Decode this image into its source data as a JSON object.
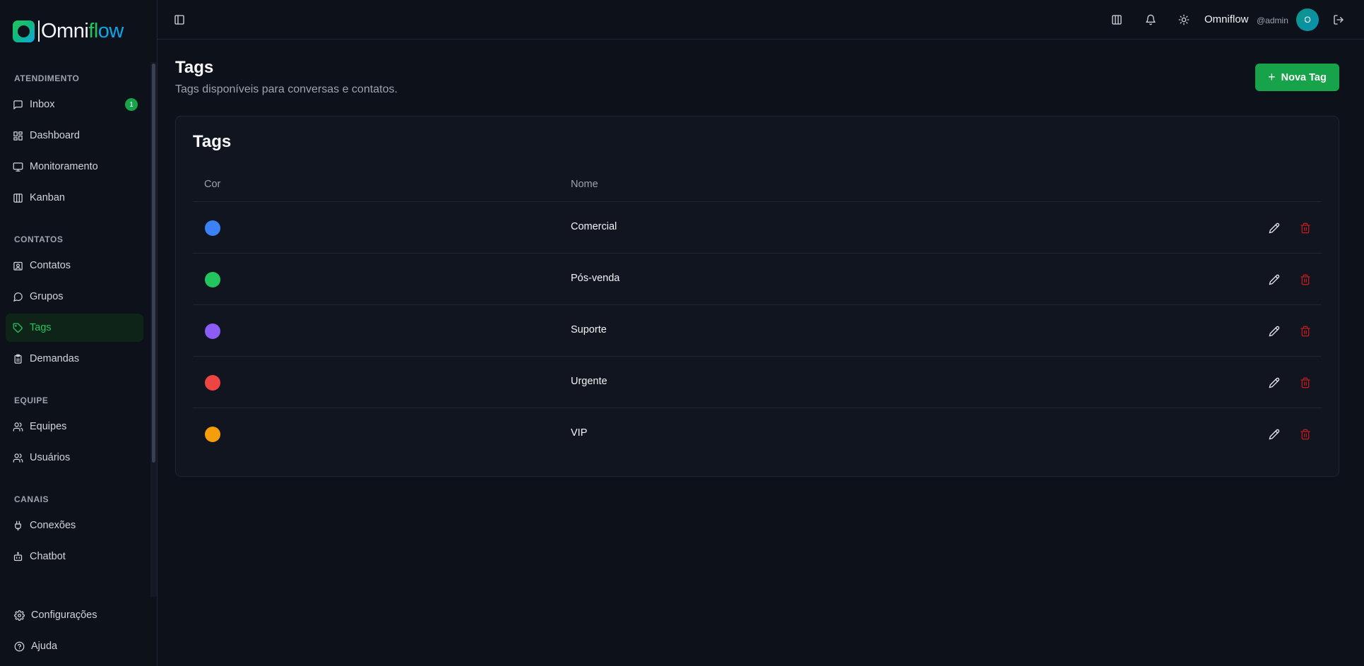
{
  "brand": {
    "logo_text_a": "Omni",
    "logo_text_b": "fl",
    "logo_text_c": "ow"
  },
  "sidebar": {
    "sections": [
      {
        "title": "ATENDIMENTO"
      },
      {
        "title": "CONTATOS"
      },
      {
        "title": "EQUIPE"
      },
      {
        "title": "CANAIS"
      }
    ],
    "items": [
      {
        "label": "Inbox",
        "icon": "message-square-icon",
        "badge": "1"
      },
      {
        "label": "Dashboard",
        "icon": "layout-dashboard-icon"
      },
      {
        "label": "Monitoramento",
        "icon": "monitor-icon"
      },
      {
        "label": "Kanban",
        "icon": "kanban-icon"
      },
      {
        "label": "Contatos",
        "icon": "contact-icon"
      },
      {
        "label": "Grupos",
        "icon": "message-circle-icon"
      },
      {
        "label": "Tags",
        "icon": "tag-icon",
        "active": true
      },
      {
        "label": "Demandas",
        "icon": "clipboard-icon"
      },
      {
        "label": "Equipes",
        "icon": "users-icon"
      },
      {
        "label": "Usuários",
        "icon": "users-icon"
      },
      {
        "label": "Conexões",
        "icon": "plug-icon"
      },
      {
        "label": "Chatbot",
        "icon": "bot-icon"
      }
    ],
    "bottom": [
      {
        "label": "Configurações",
        "icon": "gear-icon"
      },
      {
        "label": "Ajuda",
        "icon": "help-circle-icon"
      }
    ]
  },
  "header": {
    "user_name": "Omniflow",
    "user_handle": "@admin",
    "avatar_initial": "O"
  },
  "page": {
    "title": "Tags",
    "subtitle": "Tags disponíveis para conversas e contatos.",
    "new_button": "Nova Tag"
  },
  "table": {
    "card_title": "Tags",
    "columns": [
      "Cor",
      "Nome"
    ],
    "rows": [
      {
        "name": "Comercial",
        "color": "#3b82f6"
      },
      {
        "name": "Pós-venda",
        "color": "#22c55e"
      },
      {
        "name": "Suporte",
        "color": "#8b5cf6"
      },
      {
        "name": "Urgente",
        "color": "#ef4444"
      },
      {
        "name": "VIP",
        "color": "#f59e0b"
      }
    ]
  },
  "colors": {
    "accent": "#16a34a",
    "background": "#0d111a",
    "danger": "#b91c1c"
  }
}
